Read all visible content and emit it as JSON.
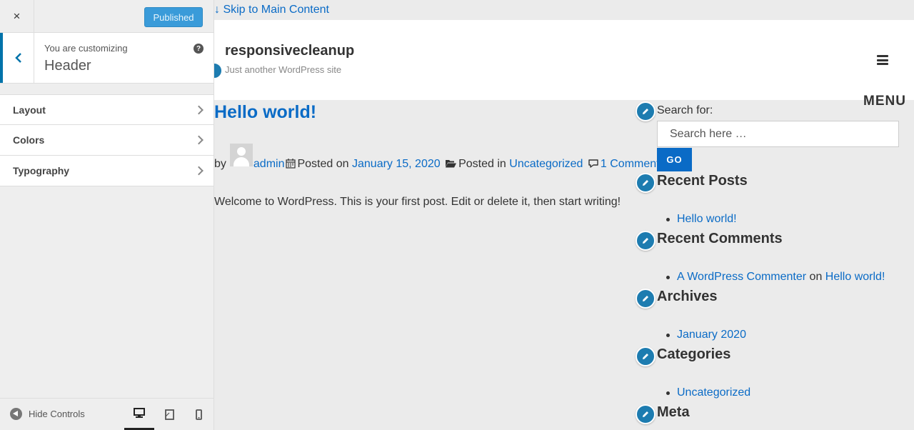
{
  "customizer": {
    "close_label": "×",
    "publish_label": "Published",
    "customizing_label": "You are customizing",
    "panel_title": "Header",
    "help_label": "?",
    "sections": [
      {
        "label": "Layout"
      },
      {
        "label": "Colors"
      },
      {
        "label": "Typography"
      }
    ],
    "footer": {
      "hide_controls_label": "Hide Controls",
      "devices": [
        "desktop",
        "tablet",
        "mobile"
      ],
      "active_device": "desktop"
    }
  },
  "preview": {
    "skip_link": "↓ Skip to Main Content",
    "site_title": "responsivecleanup",
    "site_description": "Just another WordPress site",
    "menu_label": "MENU",
    "post": {
      "title": "Hello world!",
      "by": "by",
      "author": "admin",
      "posted_on": "Posted on",
      "date": "January 15, 2020",
      "posted_in": "Posted in",
      "category": "Uncategorized",
      "comments": "1 Comment",
      "content": "Welcome to WordPress. This is your first post. Edit or delete it, then start writing!"
    },
    "sidebar": {
      "search_label": "Search for:",
      "search_placeholder": "Search here …",
      "go_label": "GO",
      "recent_posts_title": "Recent Posts",
      "recent_posts": [
        "Hello world!"
      ],
      "recent_comments_title": "Recent Comments",
      "recent_comment": {
        "author": "A WordPress Commenter",
        "on": "on",
        "post": "Hello world!"
      },
      "archives_title": "Archives",
      "archives": [
        "January 2020"
      ],
      "categories_title": "Categories",
      "categories": [
        "Uncategorized"
      ],
      "meta_title": "Meta"
    }
  },
  "colors": {
    "accent": "#0073aa",
    "link": "#0a6bc6",
    "publish_button": "#3a9bd9",
    "edit_shortcut": "#1d7cb0"
  }
}
